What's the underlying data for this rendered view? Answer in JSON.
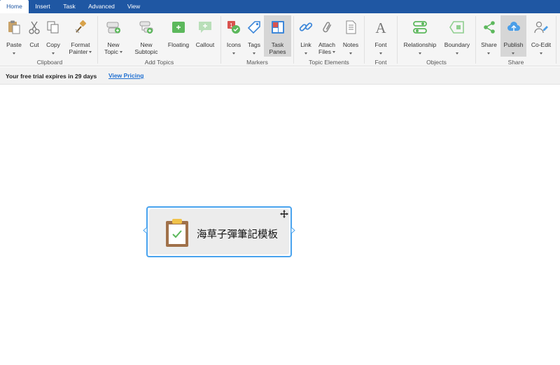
{
  "tabs": [
    {
      "label": "Home",
      "active": true
    },
    {
      "label": "Insert",
      "active": false
    },
    {
      "label": "Task",
      "active": false
    },
    {
      "label": "Advanced",
      "active": false
    },
    {
      "label": "View",
      "active": false
    }
  ],
  "ribbon": {
    "buttons": {
      "paste": "Paste",
      "cut": "Cut",
      "copy": "Copy",
      "format_painter_1": "Format",
      "format_painter_2": "Painter",
      "new_topic_1": "New",
      "new_topic_2": "Topic",
      "new_subtopic_1": "New",
      "new_subtopic_2": "Subtopic",
      "floating": "Floating",
      "callout": "Callout",
      "icons": "Icons",
      "tags": "Tags",
      "task_panes_1": "Task",
      "task_panes_2": "Panes",
      "link": "Link",
      "attach_files_1": "Attach",
      "attach_files_2": "Files",
      "notes": "Notes",
      "font": "Font",
      "relationship": "Relationship",
      "boundary": "Boundary",
      "share": "Share",
      "publish": "Publish",
      "co_edit": "Co-Edit"
    },
    "groups": {
      "clipboard": "Clipboard",
      "add_topics": "Add Topics",
      "markers": "Markers",
      "topic_elements": "Topic Elements",
      "font": "Font",
      "objects": "Objects",
      "share": "Share"
    }
  },
  "trial": {
    "text": "Your free trial expires in 29 days",
    "link": "View Pricing"
  },
  "topic": {
    "text": "海草子彈筆記模板",
    "icon": "clipboard-check-icon"
  },
  "colors": {
    "brand": "#1f57a3",
    "selection": "#49a3ee",
    "icon_green": "#5cb85c",
    "link": "#1f6fd1"
  }
}
